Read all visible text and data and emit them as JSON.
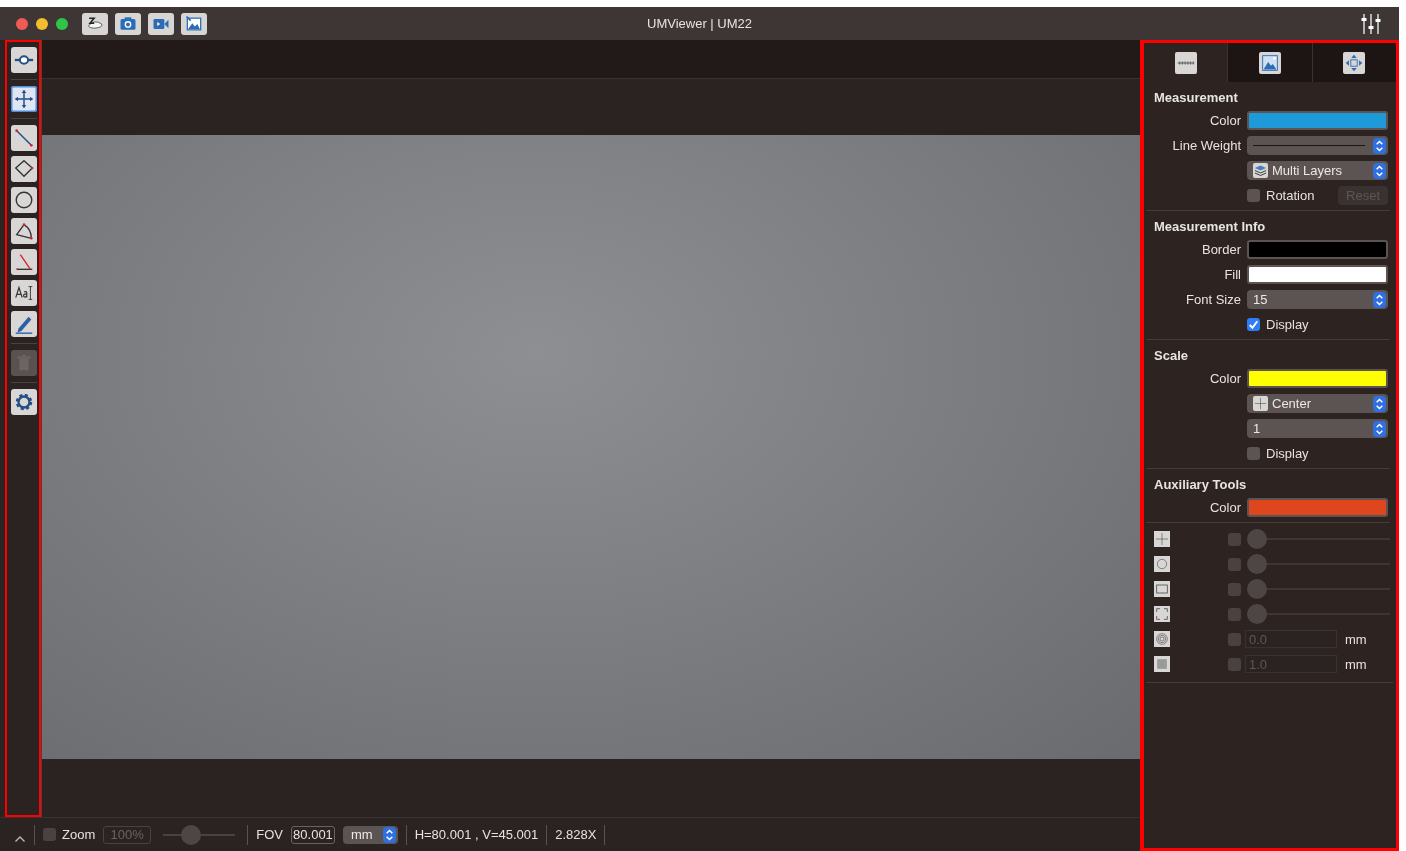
{
  "window": {
    "title": "UMViewer | UM22"
  },
  "title_tools": [
    {
      "kind": "microscope"
    },
    {
      "kind": "camera"
    },
    {
      "kind": "video"
    },
    {
      "kind": "gallery"
    }
  ],
  "left_toolbar": [
    {
      "kind": "connect",
      "selected": false,
      "disabled": false
    },
    {
      "kind": "move",
      "selected": true,
      "disabled": false
    },
    {
      "kind": "line",
      "selected": false,
      "disabled": false
    },
    {
      "kind": "rectangle",
      "selected": false,
      "disabled": false
    },
    {
      "kind": "circle",
      "selected": false,
      "disabled": false
    },
    {
      "kind": "arc",
      "selected": false,
      "disabled": false
    },
    {
      "kind": "angle",
      "selected": false,
      "disabled": false
    },
    {
      "kind": "text",
      "selected": false,
      "disabled": false
    },
    {
      "kind": "pen",
      "selected": false,
      "disabled": false
    },
    {
      "kind": "trash",
      "selected": false,
      "disabled": true
    },
    {
      "kind": "settings",
      "selected": false,
      "disabled": false
    }
  ],
  "panel": {
    "tabs": [
      {
        "kind": "ruler",
        "selected": true
      },
      {
        "kind": "image",
        "selected": false
      },
      {
        "kind": "view",
        "selected": false
      }
    ],
    "sections": [
      {
        "title": "Measurement",
        "rows": [
          {
            "kind": "color",
            "label": "Color",
            "color": "#1e9ad8"
          },
          {
            "kind": "lineweight",
            "label": "Line Weight"
          },
          {
            "kind": "select",
            "value": "Multi Layers"
          },
          {
            "kind": "checkbox",
            "label": "Rotation",
            "checked": false,
            "button": {
              "label": "Reset",
              "disabled": true
            }
          }
        ]
      },
      {
        "title": "Measurement Info",
        "rows": [
          {
            "kind": "color",
            "label": "Border",
            "color": "#000000"
          },
          {
            "kind": "color",
            "label": "Fill",
            "color": "#ffffff"
          },
          {
            "kind": "select",
            "label": "Font Size",
            "value": "15"
          },
          {
            "kind": "checkbox",
            "label": "Display",
            "checked": true
          }
        ]
      },
      {
        "title": "Scale",
        "rows": [
          {
            "kind": "color",
            "label": "Color",
            "color": "#ffff00"
          },
          {
            "kind": "select",
            "value": "Center"
          },
          {
            "kind": "select",
            "value": "1"
          },
          {
            "kind": "checkbox",
            "label": "Display",
            "checked": false
          }
        ]
      },
      {
        "title": "Auxiliary Tools",
        "rows": [
          {
            "kind": "color",
            "label": "Color",
            "color": "#e0461e"
          }
        ]
      }
    ],
    "aux_tools": [
      {
        "kind": "crosshair",
        "checked": false,
        "level": 0
      },
      {
        "kind": "circle",
        "checked": false,
        "level": 0
      },
      {
        "kind": "rectangle",
        "checked": false,
        "level": 0
      },
      {
        "kind": "corners",
        "checked": false,
        "level": 0
      },
      {
        "kind": "rings",
        "checked": false,
        "value": "0.0",
        "unit": "mm"
      },
      {
        "kind": "grid",
        "checked": false,
        "value": "1.0",
        "unit": "mm"
      }
    ]
  },
  "status_bar": {
    "zoom": {
      "checked": false,
      "label": "Zoom",
      "value": "100%",
      "level": 0.35
    },
    "fov": {
      "label": "FOV",
      "value": "80.001",
      "unit": "mm"
    },
    "dimensions": "H=80.001 , V=45.001",
    "magnification": "2.828X"
  }
}
